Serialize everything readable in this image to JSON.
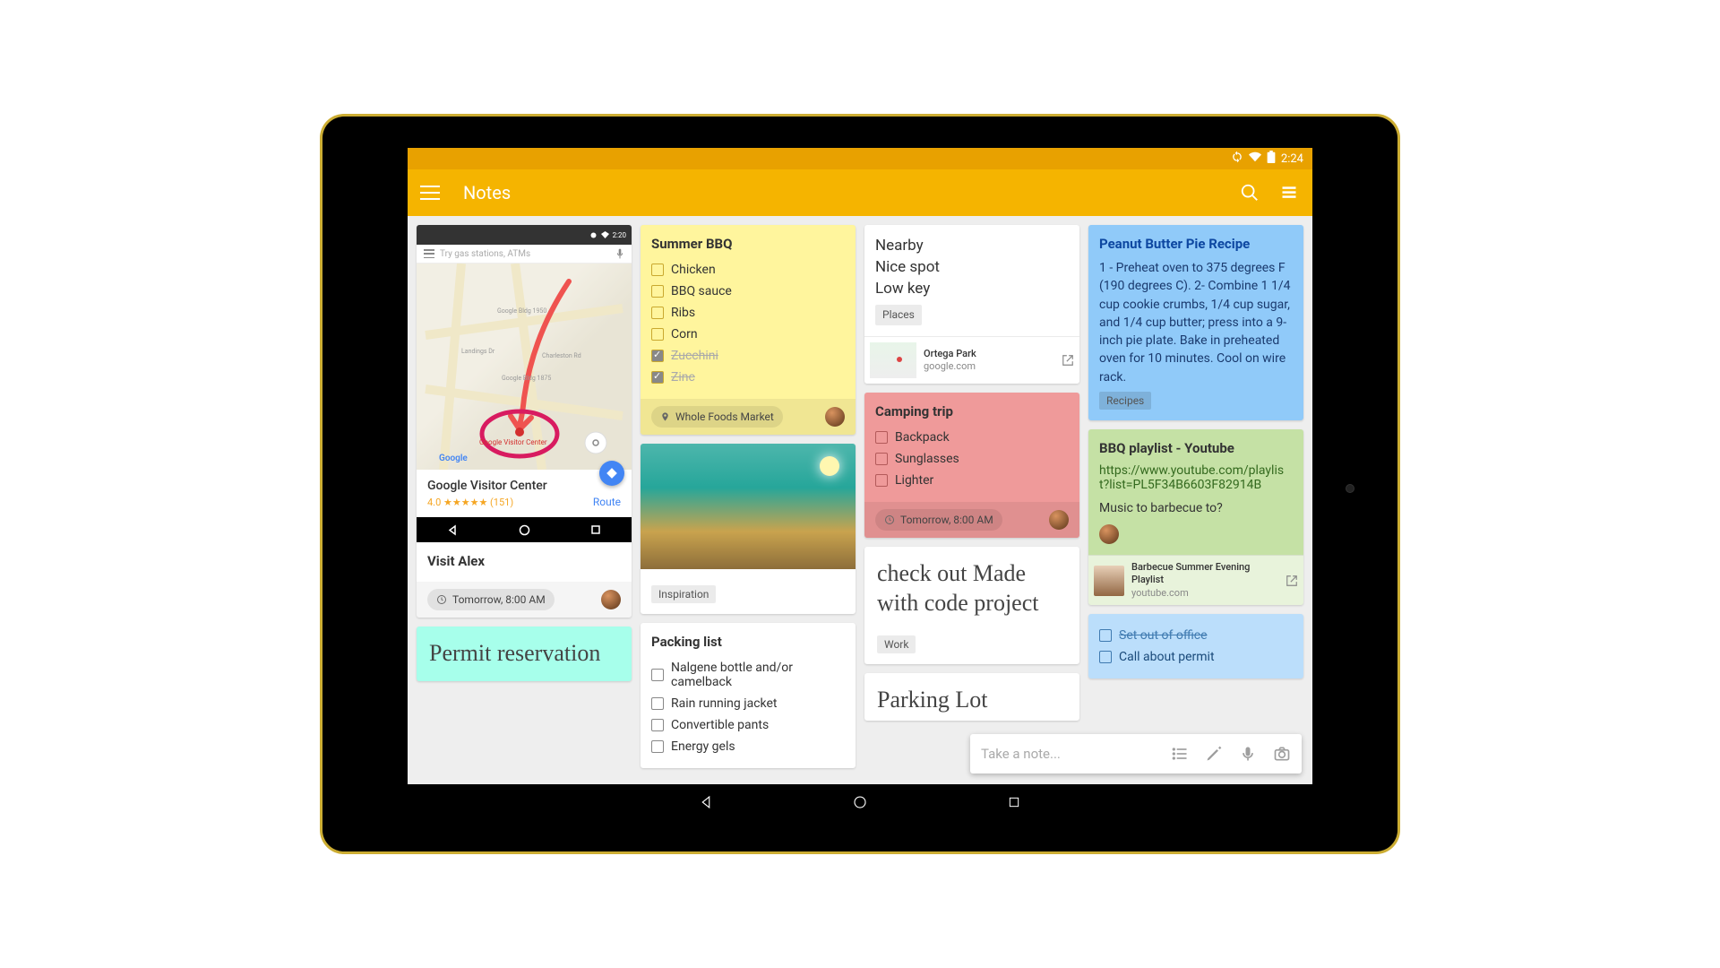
{
  "status_bar": {
    "time": "2:24"
  },
  "app_bar": {
    "title": "Notes"
  },
  "notes": {
    "visit_alex": {
      "title": "Visit Alex",
      "reminder": "Tomorrow, 8:00 AM"
    },
    "map_card": {
      "search_placeholder": "Try gas stations, ATMs",
      "place_name": "Google Visitor Center",
      "rating_text": "4.0 ★★★★★ (151)",
      "route_label": "Route"
    },
    "permit": {
      "text": "Permit reservation"
    },
    "summer_bbq": {
      "title": "Summer BBQ",
      "items": [
        {
          "label": "Chicken",
          "done": false
        },
        {
          "label": "BBQ sauce",
          "done": false
        },
        {
          "label": "Ribs",
          "done": false
        },
        {
          "label": "Corn",
          "done": false
        },
        {
          "label": "Zucchini",
          "done": true
        },
        {
          "label": "Zinc",
          "done": true
        }
      ],
      "location": "Whole Foods Market"
    },
    "inspiration": {
      "tag": "Inspiration"
    },
    "packing": {
      "title": "Packing list",
      "items": [
        {
          "label": "Nalgene bottle and/or camelback",
          "done": false
        },
        {
          "label": "Rain running jacket",
          "done": false
        },
        {
          "label": "Convertible pants",
          "done": false
        },
        {
          "label": "Energy gels",
          "done": false
        }
      ]
    },
    "nearby": {
      "lines": [
        "Nearby",
        "Nice spot",
        "Low key"
      ],
      "tag": "Places",
      "link_title": "Ortega Park",
      "link_source": "google.com"
    },
    "camping": {
      "title": "Camping trip",
      "items": [
        {
          "label": "Backpack",
          "done": false
        },
        {
          "label": "Sunglasses",
          "done": false
        },
        {
          "label": "Lighter",
          "done": false
        }
      ],
      "reminder": "Tomorrow, 8:00 AM"
    },
    "checkout": {
      "text": "check out Made with code project",
      "tag": "Work"
    },
    "parking": {
      "text": "Parking Lot"
    },
    "recipe": {
      "title": "Peanut Butter Pie Recipe",
      "body": "1 - Preheat oven to 375 degrees F (190 degrees C). 2- Combine 1 1/4 cup cookie crumbs, 1/4 cup sugar, and 1/4 cup butter; press into a 9-inch pie plate. Bake in preheated oven for 10 minutes. Cool on wire rack.",
      "tag": "Recipes"
    },
    "playlist": {
      "title": "BBQ playlist - Youtube",
      "url": "https://www.youtube.com/playlist?list=PL5F34B6603F82914B",
      "caption": "Music to barbecue to?",
      "link_title": "Barbecue Summer Evening Playlist",
      "link_source": "youtube.com"
    },
    "todo_blue": {
      "items": [
        {
          "label": "Set out of office",
          "done": false
        },
        {
          "label": "Call about permit",
          "done": false
        }
      ]
    }
  },
  "compose": {
    "placeholder": "Take a note..."
  }
}
